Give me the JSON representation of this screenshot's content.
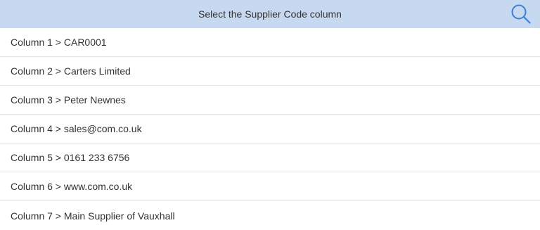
{
  "header": {
    "title": "Select the Supplier Code column",
    "search_icon": "search-icon"
  },
  "columns": [
    {
      "label": "Column 1 > CAR0001"
    },
    {
      "label": "Column 2 > Carters Limited"
    },
    {
      "label": "Column 3 > Peter Newnes"
    },
    {
      "label": "Column 4 > sales@com.co.uk"
    },
    {
      "label": "Column 5 > 0161 233 6756"
    },
    {
      "label": "Column 6 > www.com.co.uk"
    },
    {
      "label": "Column 7 > Main Supplier of Vauxhall"
    }
  ],
  "colors": {
    "header_bg": "#c6d9f1",
    "icon": "#3b7fd4"
  }
}
